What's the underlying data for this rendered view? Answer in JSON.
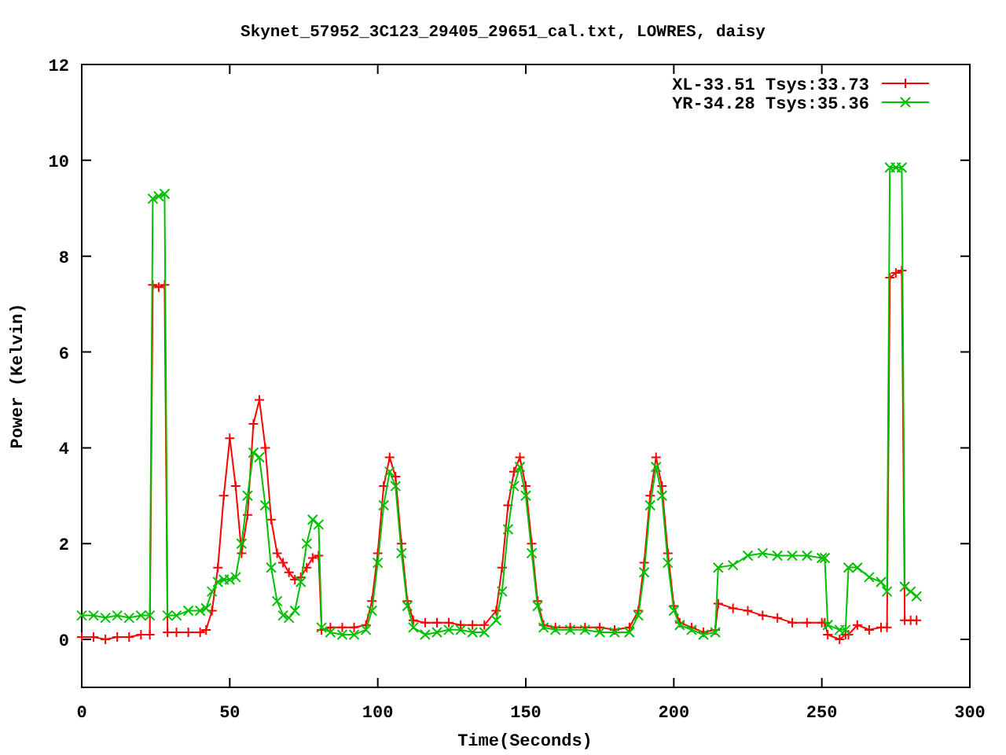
{
  "chart_data": {
    "type": "line",
    "title": "Skynet_57952_3C123_29405_29651_cal.txt, LOWRES, daisy",
    "xlabel": "Time(Seconds)",
    "ylabel": "Power (Kelvin)",
    "x": [
      0,
      4,
      8,
      12,
      16,
      20,
      23,
      24,
      26,
      28,
      29,
      32,
      36,
      40,
      42,
      44,
      46,
      48,
      50,
      52,
      54,
      56,
      58,
      60,
      62,
      64,
      66,
      68,
      70,
      72,
      74,
      76,
      78,
      80,
      81,
      84,
      88,
      92,
      96,
      98,
      100,
      102,
      104,
      106,
      108,
      110,
      112,
      116,
      120,
      124,
      128,
      132,
      136,
      140,
      142,
      144,
      146,
      148,
      150,
      152,
      154,
      156,
      160,
      165,
      170,
      175,
      180,
      185,
      188,
      190,
      192,
      194,
      196,
      198,
      200,
      202,
      206,
      210,
      214,
      215,
      220,
      225,
      230,
      235,
      240,
      245,
      250,
      251,
      252,
      256,
      258,
      259,
      262,
      266,
      270,
      272,
      273,
      275,
      277,
      278,
      280,
      282
    ],
    "series": [
      {
        "name": "XL-33.51 Tsys:33.73",
        "color": "#ff0000",
        "marker": "plus",
        "values": [
          0.05,
          0.05,
          0.0,
          0.05,
          0.05,
          0.1,
          0.1,
          7.4,
          7.35,
          7.4,
          0.15,
          0.15,
          0.15,
          0.15,
          0.2,
          0.6,
          1.5,
          3.0,
          4.2,
          3.2,
          1.8,
          2.6,
          4.5,
          5.0,
          4.0,
          2.5,
          1.8,
          1.6,
          1.4,
          1.25,
          1.3,
          1.5,
          1.7,
          1.75,
          0.2,
          0.25,
          0.25,
          0.25,
          0.3,
          0.8,
          1.8,
          3.2,
          3.8,
          3.4,
          2.0,
          0.8,
          0.4,
          0.35,
          0.35,
          0.35,
          0.3,
          0.3,
          0.3,
          0.6,
          1.5,
          2.8,
          3.5,
          3.8,
          3.2,
          2.0,
          0.8,
          0.3,
          0.25,
          0.25,
          0.25,
          0.25,
          0.2,
          0.25,
          0.6,
          1.6,
          3.0,
          3.8,
          3.2,
          1.8,
          0.7,
          0.35,
          0.25,
          0.15,
          0.2,
          0.75,
          0.65,
          0.6,
          0.5,
          0.45,
          0.35,
          0.35,
          0.35,
          0.35,
          0.1,
          0.0,
          0.1,
          0.1,
          0.3,
          0.2,
          0.25,
          0.25,
          7.55,
          7.65,
          7.7,
          0.4,
          0.4,
          0.4
        ]
      },
      {
        "name": "YR-34.28 Tsys:35.36",
        "color": "#00c000",
        "marker": "cross",
        "values": [
          0.5,
          0.5,
          0.45,
          0.5,
          0.45,
          0.5,
          0.5,
          9.2,
          9.25,
          9.3,
          0.5,
          0.5,
          0.6,
          0.6,
          0.65,
          1.0,
          1.2,
          1.25,
          1.25,
          1.3,
          2.0,
          3.0,
          3.9,
          3.8,
          2.8,
          1.5,
          0.8,
          0.5,
          0.45,
          0.6,
          1.2,
          2.0,
          2.5,
          2.4,
          0.25,
          0.15,
          0.1,
          0.1,
          0.2,
          0.6,
          1.6,
          2.8,
          3.5,
          3.2,
          1.8,
          0.7,
          0.25,
          0.1,
          0.15,
          0.2,
          0.2,
          0.15,
          0.15,
          0.4,
          1.0,
          2.3,
          3.2,
          3.6,
          3.0,
          1.8,
          0.7,
          0.25,
          0.2,
          0.2,
          0.2,
          0.15,
          0.15,
          0.15,
          0.5,
          1.4,
          2.8,
          3.6,
          3.0,
          1.6,
          0.6,
          0.3,
          0.2,
          0.1,
          0.15,
          1.5,
          1.55,
          1.75,
          1.8,
          1.75,
          1.75,
          1.75,
          1.7,
          1.7,
          0.3,
          0.2,
          0.2,
          1.5,
          1.5,
          1.3,
          1.2,
          1.0,
          9.85,
          9.85,
          9.85,
          1.1,
          1.0,
          0.9
        ]
      }
    ],
    "legend": true,
    "xlim": [
      0,
      300
    ],
    "ylim": [
      -1,
      12
    ],
    "xticks": [
      0,
      50,
      100,
      150,
      200,
      250,
      300
    ],
    "yticks": [
      0,
      2,
      4,
      6,
      8,
      10,
      12
    ]
  }
}
